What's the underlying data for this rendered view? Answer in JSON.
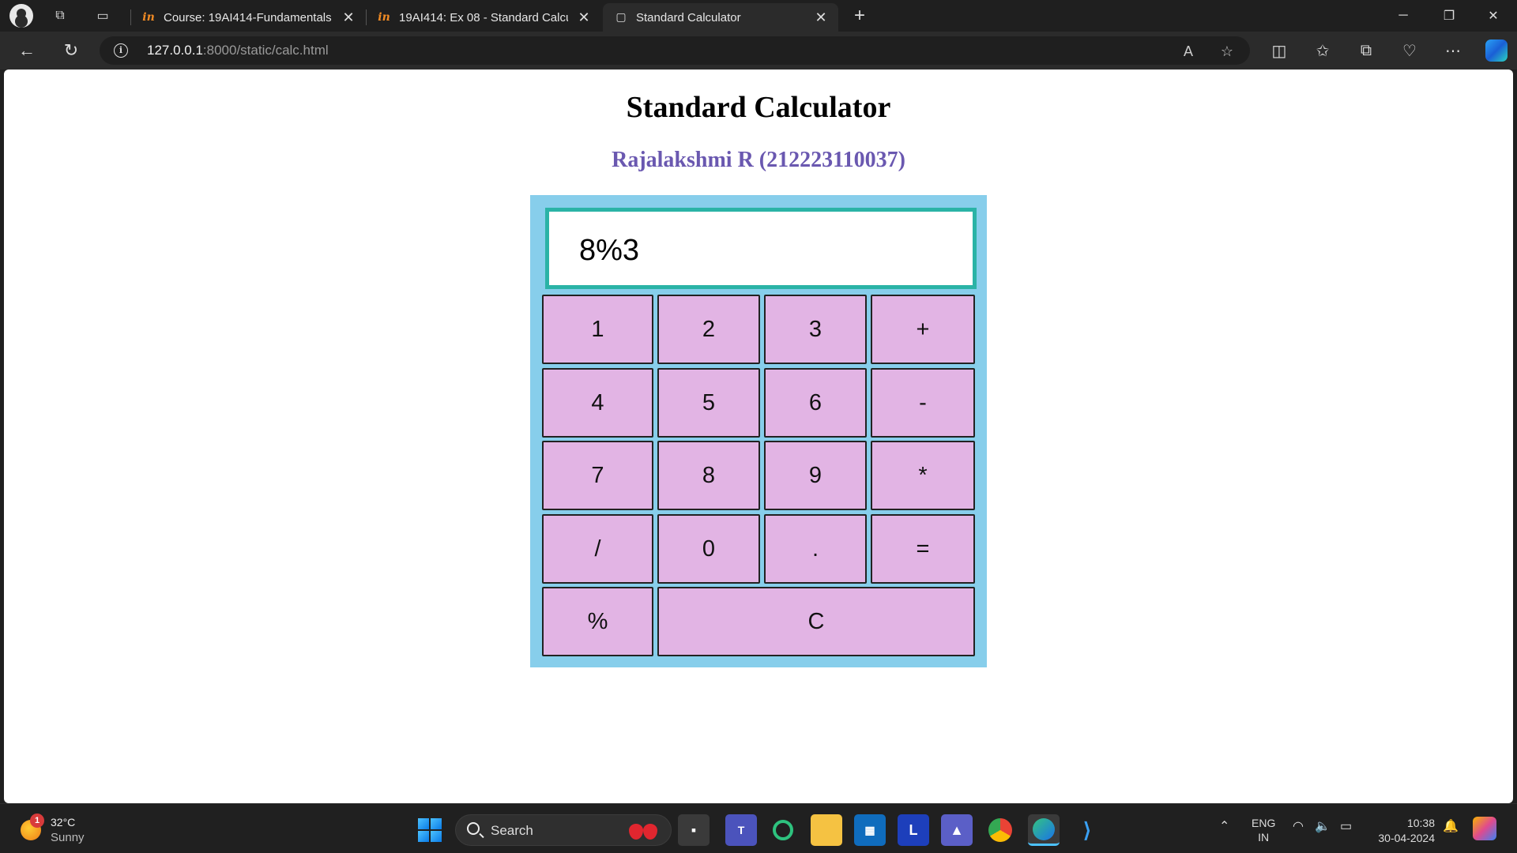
{
  "browser": {
    "tabs": [
      {
        "favicon": "in",
        "title": "Course: 19AI414-Fundamentals o",
        "close": "✕"
      },
      {
        "favicon": "in",
        "title": "19AI414: Ex 08 - Standard Calcula",
        "close": "✕"
      },
      {
        "favicon": "▢",
        "title": "Standard Calculator",
        "close": "✕"
      }
    ],
    "new_tab": "+",
    "url_host": "127.0.0.1",
    "url_rest": ":8000/static/calc.html"
  },
  "page": {
    "title": "Standard Calculator",
    "author": "Rajalakshmi R (212223110037)"
  },
  "calculator": {
    "display": "8%3",
    "keys": [
      "1",
      "2",
      "3",
      "+",
      "4",
      "5",
      "6",
      "-",
      "7",
      "8",
      "9",
      "*",
      "/",
      "0",
      ".",
      "=",
      "%",
      "C"
    ],
    "colors": {
      "frame": "#87ceeb",
      "display_border": "#2ab3a6",
      "key_bg": "#e2b4e4"
    }
  },
  "taskbar": {
    "weather_badge": "1",
    "temperature": "32°C",
    "condition": "Sunny",
    "search_label": "Search",
    "lang_line1": "ENG",
    "lang_line2": "IN",
    "time": "10:38",
    "date": "30-04-2024"
  }
}
